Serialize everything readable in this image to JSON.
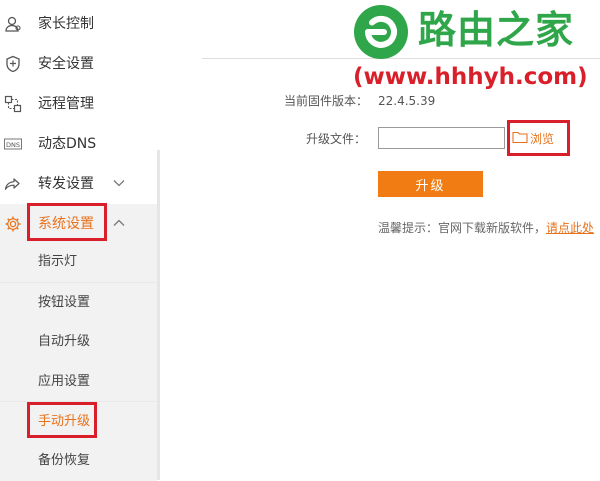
{
  "sidebar": {
    "items": [
      {
        "label": "家长控制",
        "icon": "user-control-icon"
      },
      {
        "label": "安全设置",
        "icon": "shield-icon"
      },
      {
        "label": "远程管理",
        "icon": "remote-icon"
      },
      {
        "label": "动态DNS",
        "icon": "dns-icon"
      },
      {
        "label": "转发设置",
        "icon": "forward-icon"
      },
      {
        "label": "系统设置",
        "icon": "gear-icon"
      }
    ],
    "subitems": [
      {
        "label": "指示灯"
      },
      {
        "label": "按钮设置"
      },
      {
        "label": "自动升级"
      },
      {
        "label": "应用设置"
      },
      {
        "label": "手动升级"
      },
      {
        "label": "备份恢复"
      }
    ]
  },
  "dns_icon_text": "DNS",
  "firmware": {
    "version_label": "当前固件版本：",
    "version_value": "22.4.5.39",
    "file_label": "升级文件：",
    "file_value": "",
    "browse_label": "浏览",
    "upgrade_label": "升级",
    "hint_text": "温馨提示：官网下载新版软件，",
    "hint_link": "请点此处"
  },
  "watermark": {
    "title": "路由之家",
    "url": "(www.hhhyh.com)"
  },
  "colors": {
    "accent": "#f07c13",
    "highlight_box": "#d9202a",
    "watermark_green": "#2fa64a"
  }
}
